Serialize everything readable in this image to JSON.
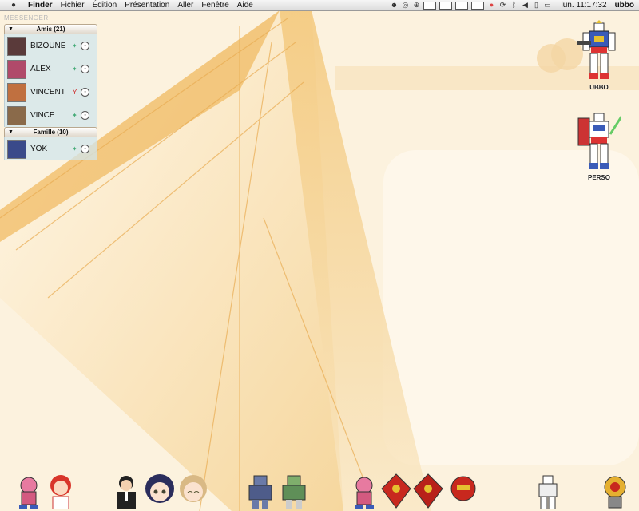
{
  "menubar": {
    "apple_icon": "apple-icon",
    "app": "Finder",
    "menus": [
      "Fichier",
      "Édition",
      "Présentation",
      "Aller",
      "Fenêtre",
      "Aide"
    ],
    "status_icons": [
      "alien-icon",
      "lifebuoy-icon",
      "compass-icon",
      "space-1-icon",
      "space-2-icon",
      "space-3-icon",
      "space-4-icon",
      "flag-icon",
      "sync-icon",
      "bluetooth-icon",
      "volume-icon",
      "battery-icon",
      "display-icon"
    ],
    "clock": "lun. 11:17:32",
    "user": "ubbo"
  },
  "messenger": {
    "title": "MESSENGER",
    "groups": [
      {
        "name": "Amis (21)",
        "contacts": [
          {
            "name": "BIZOUNE",
            "avatar_color": "#5a3a3a"
          },
          {
            "name": "ALEX",
            "avatar_color": "#b04a6a"
          },
          {
            "name": "VINCENT",
            "avatar_color": "#c07040"
          },
          {
            "name": "VINCE",
            "avatar_color": "#8a6a4a"
          }
        ]
      },
      {
        "name": "Famille (10)",
        "contacts": [
          {
            "name": "YOK",
            "avatar_color": "#3a4a8a"
          }
        ]
      }
    ]
  },
  "desktop_icons": [
    {
      "label": "UBBO",
      "icon": "robot-gundam-icon"
    },
    {
      "label": "PERSO",
      "icon": "robot-shield-icon"
    }
  ],
  "dock": [
    "bear-robot-icon",
    "red-hair-girl-icon",
    "agent-man-icon",
    "dark-hair-girl-icon",
    "blonde-girl-icon",
    "blue-robot-icon",
    "green-robot-icon",
    "bear-robot-2-icon",
    "red-robot-1-icon",
    "red-robot-2-icon",
    "red-robot-3-icon",
    "white-gundam-icon",
    "gold-robot-icon"
  ],
  "colors": {
    "wallpaper": "#fbecd0",
    "accent": "#e8a640",
    "messenger_bg": "#d2e6ec"
  }
}
